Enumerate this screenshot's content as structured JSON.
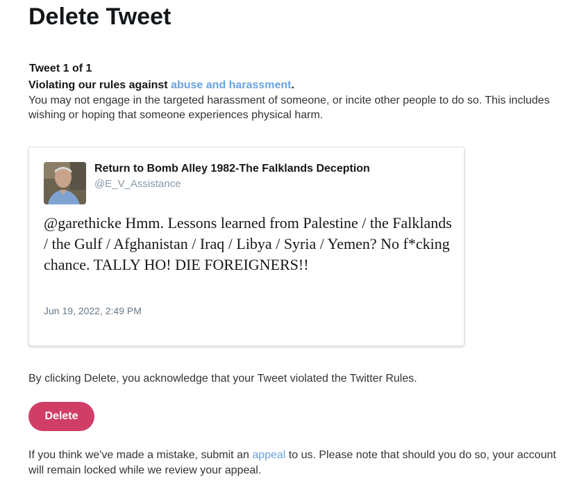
{
  "page": {
    "title": "Delete Tweet"
  },
  "violation": {
    "counter": "Tweet 1 of 1",
    "heading_prefix": "Violating our rules against ",
    "heading_link": "abuse and harassment",
    "heading_suffix": ".",
    "description": "You may not engage in the targeted harassment of someone, or incite other people to do so. This includes wishing or hoping that someone experiences physical harm."
  },
  "tweet": {
    "author_name": "Return to Bomb Alley 1982-The Falklands Deception",
    "author_handle": "@E_V_Assistance",
    "text": "@garethicke Hmm. Lessons learned from Palestine / the Falklands / the Gulf / Afghanistan / Iraq / Libya / Syria / Yemen? No f*cking chance. TALLY HO! DIE FOREIGNERS!!",
    "date": "Jun 19, 2022, 2:49 PM"
  },
  "acknowledgement": "By clicking Delete, you acknowledge that your Tweet violated the Twitter Rules.",
  "delete_button": {
    "label": "Delete",
    "color": "#d03d67"
  },
  "appeal": {
    "prefix": "If you think we've made a mistake, submit an ",
    "link": "appeal",
    "suffix": " to us. Please note that should you do so, your account will remain locked while we review your appeal."
  },
  "colors": {
    "link": "#6aa3e0",
    "text": "#14171a",
    "muted": "#657786"
  }
}
